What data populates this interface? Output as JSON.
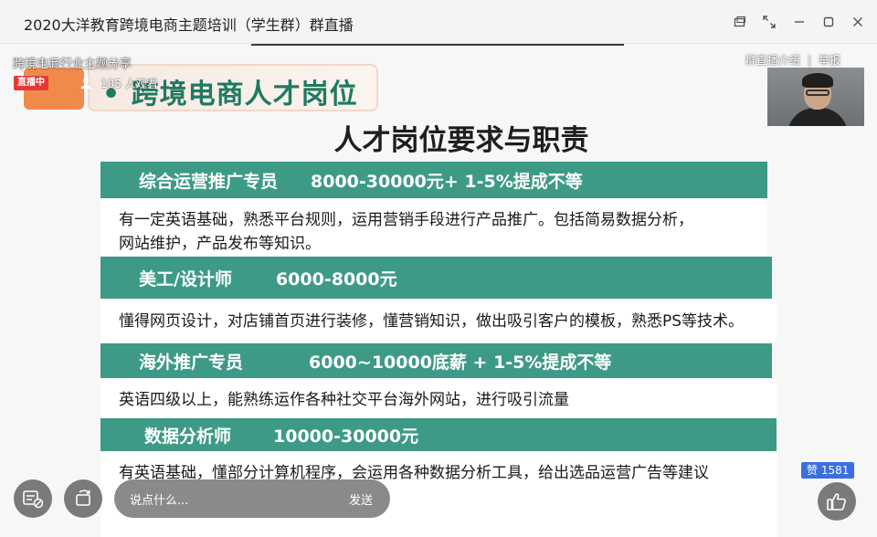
{
  "window": {
    "title": "2020大洋教育跨境电商主题培训（学生群）群直播",
    "controls": [
      "restore-window",
      "fullscreen",
      "minimize",
      "maximize",
      "close"
    ]
  },
  "live": {
    "session_title": "跨境电商行业主题分享",
    "status_badge": "直播中",
    "viewers_text": "105 人观看",
    "links": {
      "intro": "群直播介绍",
      "separator": "|",
      "report": "举报"
    }
  },
  "slide": {
    "heading": "• 跨境电商人才岗位",
    "subtitle": "人才岗位要求与职责",
    "positions": [
      {
        "role": "综合运营推广专员",
        "salary": "8000-30000元+ 1-5%提成不等",
        "description_lines": [
          "有一定英语基础，熟悉平台规则，运用营销手段进行产品推广。包括简易数据分析，",
          "网站维护，产品发布等知识。"
        ]
      },
      {
        "role": "美工/设计师",
        "salary": "6000-8000元",
        "description_lines": [
          "懂得网页设计，对店铺首页进行装修，懂营销知识，做出吸引客户的模板，熟悉PS等技术。"
        ]
      },
      {
        "role": "海外推广专员",
        "salary": "6000~10000底薪  + 1-5%提成不等",
        "description_lines": [
          "英语四级以上，能熟练运作各种社交平台海外网站，进行吸引流量"
        ]
      },
      {
        "role": "数据分析师",
        "salary": "10000-30000元",
        "description_lines": [
          "有英语基础，懂部分计算机程序，会运用各种数据分析工具，给出选品运营广告等建议"
        ]
      }
    ]
  },
  "controls": {
    "comment_placeholder": "说点什么...",
    "send_label": "发送",
    "like_label": "赞 1581"
  },
  "colors": {
    "band": "#3d9a86",
    "heading_text": "#1f7a62",
    "live_badge": "#e53935",
    "like_badge": "#3a6fe0"
  },
  "icons": {
    "restore_window": "restore-window-icon",
    "fullscreen": "fullscreen-icon",
    "minimize": "minimize-icon",
    "maximize": "maximize-icon",
    "close": "close-icon",
    "viewers": "people-icon",
    "danmaku": "danmaku-toggle-icon",
    "rotate": "rotate-screen-icon",
    "like": "thumbs-up-icon"
  }
}
